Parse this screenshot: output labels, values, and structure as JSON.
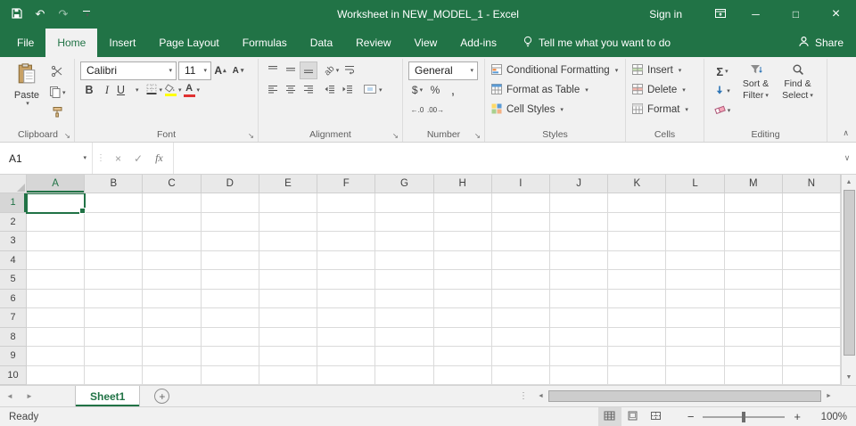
{
  "colors": {
    "accent": "#217346",
    "ribbon_bg": "#f1f1f1"
  },
  "title_bar": {
    "title": "Worksheet in NEW_MODEL_1 - Excel",
    "sign_in_label": "Sign in"
  },
  "active_tab": "Home",
  "ribbon_tabs": [
    {
      "label": "File"
    },
    {
      "label": "Home"
    },
    {
      "label": "Insert"
    },
    {
      "label": "Page Layout"
    },
    {
      "label": "Formulas"
    },
    {
      "label": "Data"
    },
    {
      "label": "Review"
    },
    {
      "label": "View"
    },
    {
      "label": "Add-ins"
    }
  ],
  "tell_me_label": "Tell me what you want to do",
  "share_label": "Share",
  "ribbon": {
    "clipboard": {
      "paste_label": "Paste",
      "group_label": "Clipboard"
    },
    "font": {
      "font_name": "Calibri",
      "font_size": "11",
      "grow_shrink_letter": "A",
      "bold_label": "B",
      "italic_label": "I",
      "underline_label": "U",
      "font_color_letter": "A",
      "fill_color_hex": "#ffff00",
      "font_color_hex": "#e03131",
      "group_label": "Font"
    },
    "alignment": {
      "orientation_label": "ab",
      "group_label": "Alignment"
    },
    "number": {
      "format_value": "General",
      "accounting_label": "$",
      "percent_label": "%",
      "comma_label": ",",
      "increase_decimal_label": "←.0",
      "decrease_decimal_label": ".00→",
      "group_label": "Number"
    },
    "styles": {
      "conditional_formatting_label": "Conditional Formatting",
      "format_as_table_label": "Format as Table",
      "cell_styles_label": "Cell Styles",
      "group_label": "Styles"
    },
    "cells": {
      "insert_label": "Insert",
      "delete_label": "Delete",
      "format_label": "Format",
      "group_label": "Cells"
    },
    "editing": {
      "autosum_label": "Σ",
      "sort_filter_line1": "Sort &",
      "sort_filter_line2": "Filter",
      "find_select_line1": "Find &",
      "find_select_line2": "Select",
      "group_label": "Editing"
    }
  },
  "formula_bar": {
    "name_box_value": "A1",
    "cancel_glyph": "×",
    "enter_glyph": "✓",
    "fx_label": "fx"
  },
  "grid": {
    "column_headers": [
      "A",
      "B",
      "C",
      "D",
      "E",
      "F",
      "G",
      "H",
      "I",
      "J",
      "K",
      "L",
      "M",
      "N"
    ],
    "row_headers": [
      "1",
      "2",
      "3",
      "4",
      "5",
      "6",
      "7",
      "8",
      "9",
      "10"
    ],
    "selected_cell": "A1"
  },
  "sheet_bar": {
    "sheet_tabs": [
      {
        "label": "Sheet1",
        "active": true
      }
    ]
  },
  "status_bar": {
    "mode_label": "Ready",
    "zoom_out_glyph": "−",
    "zoom_in_glyph": "+",
    "zoom_value": "100%"
  },
  "icons": {
    "dropdown_arrow": "▾",
    "up_arrow": "▴",
    "undo": "↶",
    "redo": "↷",
    "minimize": "─",
    "maximize": "□",
    "close": "×",
    "vertical_dots": "⋮",
    "launcher_arrow": "↘",
    "collapse_ribbon": "∧",
    "expand_formula_bar": "∨",
    "scroll_up": "▲",
    "scroll_down": "▼",
    "scroll_left": "◄",
    "scroll_right": "►",
    "tab_nav_left": "◄",
    "tab_nav_right": "►",
    "new_sheet": "+"
  }
}
